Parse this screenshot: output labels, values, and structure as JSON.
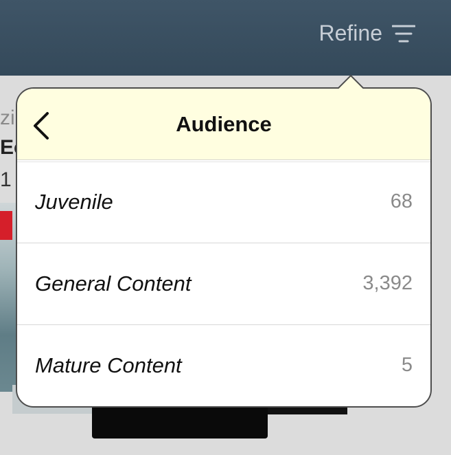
{
  "navbar": {
    "refine_label": "Refine",
    "refine_icon": "filter-lines-icon"
  },
  "background": {
    "fragment_1": "zi",
    "fragment_2": "Ec",
    "fragment_3": "1"
  },
  "popover": {
    "title": "Audience",
    "back_icon": "chevron-left-icon",
    "header_color": "#fffee0",
    "items": [
      {
        "label": "Juvenile",
        "count": "68"
      },
      {
        "label": "General Content",
        "count": "3,392"
      },
      {
        "label": "Mature Content",
        "count": "5"
      }
    ]
  }
}
